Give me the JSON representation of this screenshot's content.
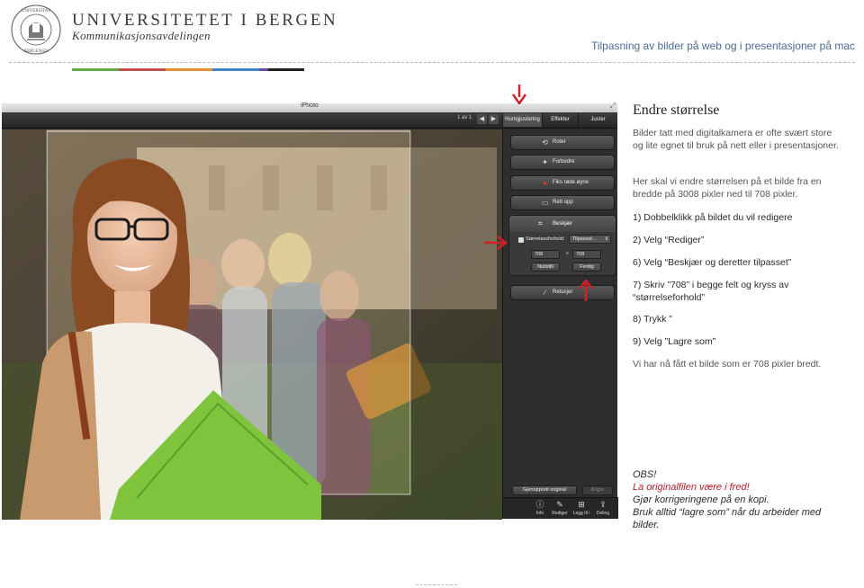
{
  "header": {
    "seal_text": "UNIVERSITAS BERGENSIS",
    "university_name": "UNIVERSITETET I BERGEN",
    "department": "Kommunikasjonsavdelingen",
    "document_title": "Tilpasning av bilder på web og i presentasjoner på mac",
    "accent_colors": [
      "#6aa84f",
      "#c0504d",
      "#e69138",
      "#3d85c6",
      "#674ea7",
      "#222222"
    ]
  },
  "iphoto": {
    "window_title": "iPhoto",
    "photo_count": "1 av 1",
    "tabs": [
      {
        "label": "Hurtigjustering",
        "active": true
      },
      {
        "label": "Effekter",
        "active": false
      },
      {
        "label": "Juster",
        "active": false
      }
    ],
    "quick_fix": {
      "rotate": "Roter",
      "enhance": "Forbedre",
      "red_eye": "Fiks røde øyne",
      "straighten": "Rett opp",
      "crop": "Beskjær",
      "retouch": "Retusjer"
    },
    "crop_panel": {
      "constrain_label": "Størrelsesforhold:",
      "constrain_value": "Tilpasset…",
      "width": "708",
      "x": "x",
      "height": "708",
      "reset": "Nullstill",
      "done": "Ferdig"
    },
    "revert_button": "Gjenopprett original",
    "undo_button": "Angre",
    "bottom_bar": [
      "Info",
      "Rediger",
      "Legg til i",
      "Deling"
    ]
  },
  "content": {
    "section_title": "Endre størrelse",
    "intro": "Bilder tatt med digitalkamera er ofte svært store og lite egnet til bruk på nett eller i presentasjoner.",
    "task": "Her skal vi endre størrelsen på et bilde fra en bredde på 3008 pixler ned til 708 pixler.",
    "steps": [
      "1) Dobbelklikk på bildet du vil redigere",
      "2) Velg “Rediger”",
      "6) Velg “Beskjær og deretter tilpasset”",
      "7) Skriv ”708” i begge felt og kryss av “størrelseforhold”",
      "8) Trykk ”",
      "9) Velg  ”Lagre som”"
    ],
    "result": "Vi har nå fått et bilde som er 708 pixler bredt.",
    "obs_title": "OBS!",
    "obs_red": "La originalfilen være i fred!",
    "obs_line2": "Gjør korrigeringene på en kopi.",
    "obs_line3": "Bruk alltid “lagre som” når du arbeider med bilder."
  }
}
